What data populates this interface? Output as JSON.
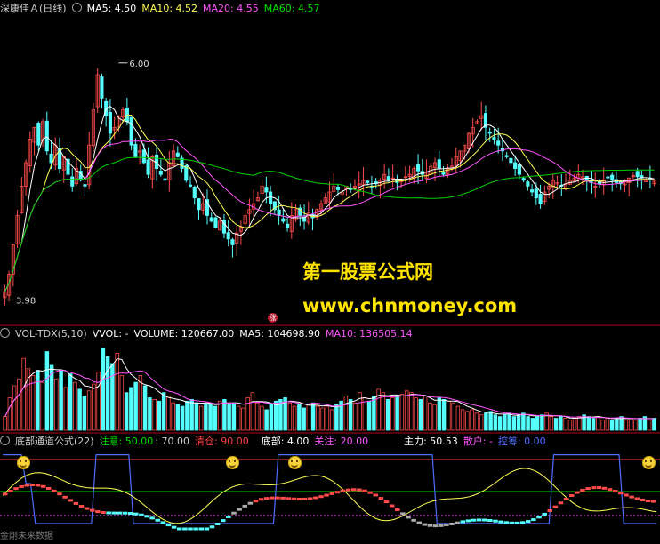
{
  "colors": {
    "bg": "#000000",
    "rise": "#ff4b4b",
    "fall": "#54ffff",
    "ma5": "#ffffff",
    "ma10": "#ffff54",
    "ma20": "#ff54ff",
    "ma60": "#00d000",
    "red": "#ff4040",
    "blue": "#4f6dff",
    "grid": "#b0001a"
  },
  "main": {
    "title": "深康佳Ａ(日线)",
    "ma5_label": "MA5: 4.50",
    "ma10_label": "MA10: 4.52",
    "ma20_label": "MA20: 4.55",
    "ma60_label": "MA60: 4.57",
    "high_label": "6.00",
    "low_label": "3.98",
    "badge": "涨"
  },
  "vol": {
    "name": "VOL-TDX(5,10)",
    "vvol": "VVOL: -",
    "volume": "VOLUME: 120667.00",
    "ma5": "MA5: 104698.90",
    "ma10": "MA10: 136505.14"
  },
  "ind": {
    "name": "底部通道公式(22)",
    "notice": "注意: 50.00",
    "val70": ": 70.00",
    "clear": "清仓: 90.00",
    "bottom": "底部: 4.00",
    "focus": "关注: 20.00",
    "main_force": "主力: 50.53",
    "retail": "散户: -",
    "chips": "控筹: 0.00",
    "footer": "金刚未来数据"
  },
  "watermark": {
    "line1": "第一股票公式网",
    "line2": "www.chnmoney.com"
  },
  "chart_data": [
    {
      "type": "candlestick",
      "title": "深康佳Ａ(日线)",
      "ylim": [
        3.9,
        6.4
      ],
      "annotations": [
        {
          "label": "6.00",
          "x": 27,
          "y": 6.0
        },
        {
          "label": "3.98",
          "x": 0,
          "y": 3.98
        }
      ],
      "closes": [
        4.05,
        4.2,
        4.45,
        4.7,
        4.95,
        5.15,
        5.35,
        5.45,
        5.3,
        5.5,
        5.25,
        5.15,
        5.3,
        5.1,
        5.2,
        5.05,
        4.95,
        5.1,
        5.0,
        4.95,
        5.3,
        5.6,
        5.9,
        5.7,
        5.55,
        5.4,
        5.45,
        5.55,
        5.6,
        5.5,
        5.3,
        5.2,
        5.25,
        5.15,
        5.05,
        5.2,
        5.1,
        5.05,
        5.0,
        5.15,
        5.25,
        5.2,
        5.1,
        5.0,
        4.95,
        4.85,
        4.75,
        4.8,
        4.7,
        4.65,
        4.6,
        4.65,
        4.55,
        4.5,
        4.45,
        4.55,
        4.6,
        4.7,
        4.75,
        4.8,
        4.85,
        4.95,
        4.9,
        4.8,
        4.75,
        4.7,
        4.65,
        4.6,
        4.7,
        4.75,
        4.7,
        4.65,
        4.72,
        4.68,
        4.75,
        4.8,
        4.85,
        4.9,
        4.95,
        4.92,
        4.9,
        4.95,
        4.92,
        4.95,
        4.97,
        5.0,
        4.98,
        4.95,
        4.97,
        5.0,
        5.05,
        5.0,
        5.02,
        4.98,
        5.0,
        5.03,
        5.05,
        5.1,
        5.08,
        5.05,
        5.07,
        5.12,
        5.15,
        5.1,
        5.05,
        5.1,
        5.12,
        5.2,
        5.25,
        5.3,
        5.4,
        5.45,
        5.5,
        5.55,
        5.45,
        5.4,
        5.35,
        5.3,
        5.25,
        5.2,
        5.15,
        5.1,
        5.05,
        5.0,
        4.95,
        4.9,
        4.85,
        4.8,
        4.9,
        4.95,
        5.0,
        4.98,
        4.95,
        4.97,
        5.0,
        5.02,
        5.05,
        5.03,
        5.0,
        4.98,
        4.95,
        4.97,
        5.0,
        5.02,
        5.0,
        4.98,
        4.97,
        5.0,
        5.02,
        5.04,
        5.03,
        5.02,
        5.0,
        5.01,
        5.0
      ],
      "ma_series": [
        {
          "name": "MA5",
          "value": 4.5
        },
        {
          "name": "MA10",
          "value": 4.52
        },
        {
          "name": "MA20",
          "value": 4.55
        },
        {
          "name": "MA60",
          "value": 4.57
        }
      ]
    },
    {
      "type": "bar",
      "title": "VOL-TDX(5,10)",
      "ylim": [
        0,
        300000
      ],
      "series": [
        {
          "name": "VOLUME",
          "last": 120667.0
        },
        {
          "name": "MA5",
          "last": 104698.9
        },
        {
          "name": "MA10",
          "last": 136505.14
        }
      ],
      "values": [
        40,
        95,
        130,
        150,
        210,
        180,
        160,
        175,
        140,
        230,
        190,
        150,
        175,
        125,
        165,
        140,
        120,
        100,
        115,
        135,
        170,
        240,
        215,
        195,
        225,
        160,
        110,
        125,
        140,
        160,
        130,
        95,
        90,
        85,
        110,
        100,
        80,
        75,
        70,
        85,
        90,
        80,
        70,
        75,
        80,
        70,
        85,
        90,
        75,
        80,
        70,
        65,
        95,
        110,
        80,
        70,
        60,
        75,
        85,
        90,
        95,
        80,
        70,
        75,
        65,
        75,
        80,
        70,
        65,
        70,
        60,
        75,
        85,
        100,
        90,
        80,
        110,
        95,
        85,
        100,
        120,
        110,
        90,
        95,
        100,
        105,
        115,
        110,
        95,
        90,
        100,
        80,
        75,
        95,
        90,
        85,
        80,
        70,
        60,
        55,
        60,
        50,
        45,
        50,
        55,
        45,
        40,
        45,
        50,
        40,
        45,
        50,
        40,
        35,
        40,
        45,
        50,
        40,
        35,
        40,
        35,
        30,
        35,
        40,
        45,
        40,
        35,
        40,
        30,
        35,
        30,
        35,
        40,
        30,
        35,
        30,
        35,
        40,
        30,
        35
      ]
    },
    {
      "type": "line",
      "title": "底部通道公式(22)",
      "ylim": [
        0,
        100
      ],
      "levels": [
        {
          "name": "注意",
          "value": 50.0
        },
        {
          "name": "清仓",
          "value": 90.0
        },
        {
          "name": "底部",
          "value": 4.0
        },
        {
          "name": "关注",
          "value": 20.0
        }
      ],
      "series": [
        {
          "name": "主力",
          "last": 50.53
        },
        {
          "name": "控筹",
          "last": 0.0
        }
      ]
    }
  ]
}
